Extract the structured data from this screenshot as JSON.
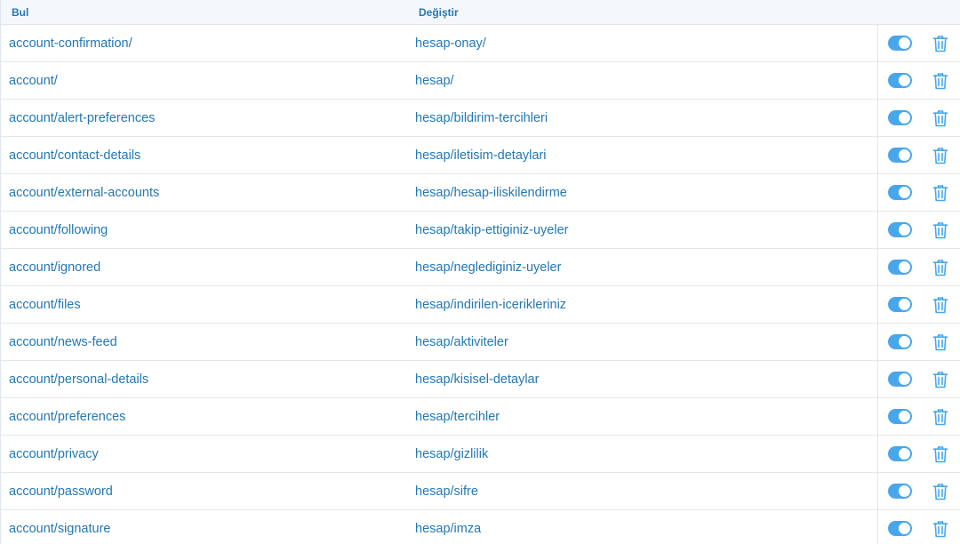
{
  "header": {
    "find_label": "Bul",
    "replace_label": "Değiştir"
  },
  "colors": {
    "link": "#2577b1",
    "toggle_on": "#47a7eb",
    "header_bg": "#f5f8fb"
  },
  "icons": {
    "toggle": "toggle-switch-icon",
    "delete": "trash-icon"
  },
  "rows": [
    {
      "find": "account-confirmation/",
      "replace": "hesap-onay/",
      "enabled": true
    },
    {
      "find": "account/",
      "replace": "hesap/",
      "enabled": true
    },
    {
      "find": "account/alert-preferences",
      "replace": "hesap/bildirim-tercihleri",
      "enabled": true
    },
    {
      "find": "account/contact-details",
      "replace": "hesap/iletisim-detaylari",
      "enabled": true
    },
    {
      "find": "account/external-accounts",
      "replace": "hesap/hesap-iliskilendirme",
      "enabled": true
    },
    {
      "find": "account/following",
      "replace": "hesap/takip-ettiginiz-uyeler",
      "enabled": true
    },
    {
      "find": "account/ignored",
      "replace": "hesap/neglediginiz-uyeler",
      "enabled": true
    },
    {
      "find": "account/files",
      "replace": "hesap/indirilen-icerikleriniz",
      "enabled": true
    },
    {
      "find": "account/news-feed",
      "replace": "hesap/aktiviteler",
      "enabled": true
    },
    {
      "find": "account/personal-details",
      "replace": "hesap/kisisel-detaylar",
      "enabled": true
    },
    {
      "find": "account/preferences",
      "replace": "hesap/tercihler",
      "enabled": true
    },
    {
      "find": "account/privacy",
      "replace": "hesap/gizlilik",
      "enabled": true
    },
    {
      "find": "account/password",
      "replace": "hesap/sifre",
      "enabled": true
    },
    {
      "find": "account/signature",
      "replace": "hesap/imza",
      "enabled": true
    }
  ]
}
